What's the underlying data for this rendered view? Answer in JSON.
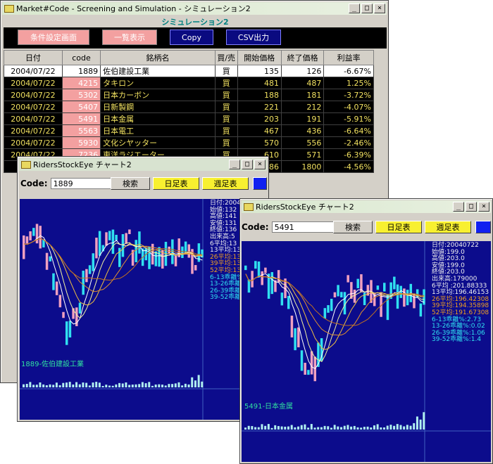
{
  "main_window": {
    "title": "Market#Code  - Screening and Simulation -    シミュレーション2",
    "subtitle": "シミュレーション2",
    "buttons": [
      "条件設定画面",
      "一覧表示",
      "Copy",
      "CSV出力"
    ],
    "columns": [
      "日付",
      "code",
      "銘柄名",
      "買/売",
      "開始価格",
      "終了価格",
      "利益率"
    ],
    "rows": [
      [
        "2004/07/22",
        "1889",
        "佐伯建設工業",
        "買",
        "135",
        "126",
        "-6.67%"
      ],
      [
        "2004/07/22",
        "4215",
        "タキロン",
        "買",
        "481",
        "487",
        "1.25%"
      ],
      [
        "2004/07/22",
        "5302",
        "日本カーボン",
        "買",
        "188",
        "181",
        "-3.72%"
      ],
      [
        "2004/07/22",
        "5407",
        "日新製鋼",
        "買",
        "221",
        "212",
        "-4.07%"
      ],
      [
        "2004/07/22",
        "5491",
        "日本金属",
        "買",
        "203",
        "191",
        "-5.91%"
      ],
      [
        "2004/07/22",
        "5563",
        "日本電工",
        "買",
        "467",
        "436",
        "-6.64%"
      ],
      [
        "2004/07/22",
        "5930",
        "文化シヤッター",
        "買",
        "570",
        "556",
        "-2.46%"
      ],
      [
        "2004/07/22",
        "7236",
        "東洋ラジエーター",
        "買",
        "610",
        "571",
        "-6.39%"
      ],
      [
        "2",
        "",
        "",
        "",
        "86",
        "1800",
        "-4.56%"
      ]
    ]
  },
  "chart1": {
    "title": "RidersStockEye チャート2",
    "code_label": "Code:",
    "code_value": "1889",
    "search_label": "検索",
    "daily_label": "日足表",
    "weekly_label": "週足表",
    "stock_label": "1889-佐伯建設工業",
    "info": [
      "日付:2004",
      "始値:132",
      "高値:141",
      "安値:131",
      "終値:136",
      "出来高:5",
      "6平均:13",
      "13平均:13",
      "26平均:13",
      "39平均:13",
      "52平均:13",
      "6-13乖離%",
      "13-26乖離",
      "26-39乖離",
      "39-52乖離"
    ]
  },
  "chart2": {
    "title": "RidersStockEye チャート2",
    "code_label": "Code:",
    "code_value": "5491",
    "search_label": "検索",
    "daily_label": "日足表",
    "weekly_label": "週足表",
    "stock_label": "5491-日本金属",
    "info": [
      "日付:20040722",
      "始値:199.0",
      "高値:203.0",
      "安値:199.0",
      "終値:203.0",
      "出来高:179000",
      "6平均 :201.88333",
      "13平均:196.46153",
      "26平均:196.42308",
      "39平均:194.35898",
      "52平均:191.67308",
      "6-13乖離%:2.73",
      "13-26乖離%:0.02",
      "26-39乖離%:1.06",
      "39-52乖離%:1.4"
    ]
  },
  "colors": {
    "chart_bg": "#0c0c8c",
    "candle": "#30e0f0",
    "accent_pink": "#f3a0a0",
    "navy_button": "#0a0a80"
  }
}
